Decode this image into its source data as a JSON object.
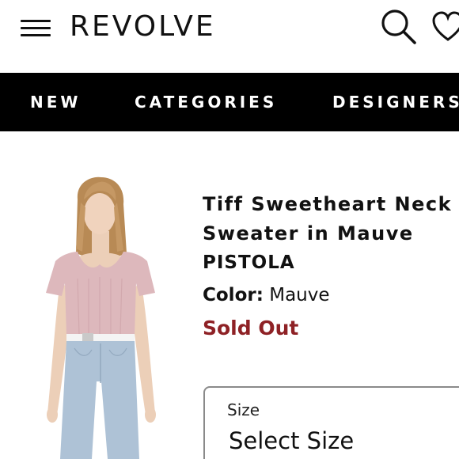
{
  "header": {
    "menu_icon": "hamburger-menu-icon",
    "logo": "REVOLVE",
    "search_icon": "search-icon",
    "wishlist_icon": "heart-icon"
  },
  "nav": {
    "items": [
      {
        "label": "NEW"
      },
      {
        "label": "CATEGORIES"
      },
      {
        "label": "DESIGNERS"
      }
    ]
  },
  "product": {
    "title_line1": "Tiff Sweetheart Neck",
    "title_line2": "Sweater in Mauve",
    "brand": "PISTOLA",
    "color_label": "Color:",
    "color_value": "Mauve",
    "status": "Sold Out",
    "image": "model-wearing-mauve-sweater-and-light-jeans"
  },
  "size": {
    "label": "Size",
    "value": "Select Size"
  },
  "colors": {
    "nav_background": "#000000",
    "sold_out": "#8e2125",
    "sweater": "#ddb8bc",
    "jeans": "#aec2d6"
  }
}
